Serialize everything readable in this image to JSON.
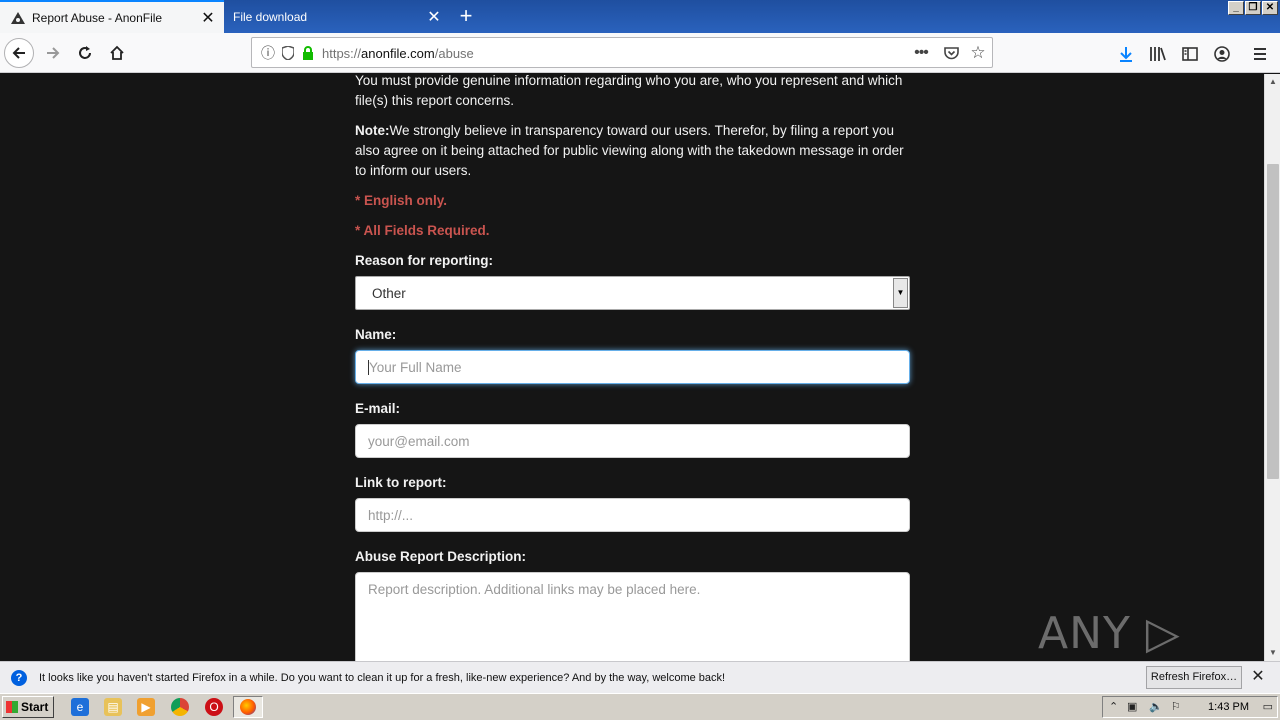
{
  "browser": {
    "tabs": [
      {
        "title": "Report Abuse - AnonFile",
        "active": true,
        "icon": "anonfile-icon"
      },
      {
        "title": "File download",
        "active": false,
        "icon": "none"
      }
    ],
    "url": {
      "scheme": "https://",
      "host": "anonfile.com",
      "path": "/abuse"
    },
    "icons": [
      "back-icon",
      "forward-icon",
      "reload-icon",
      "home-icon",
      "info-icon",
      "shield-icon",
      "lock-icon",
      "page-actions-icon",
      "pocket-icon",
      "bookmark-star-icon",
      "download-icon",
      "library-icon",
      "sidebar-icon",
      "account-icon",
      "menu-icon"
    ]
  },
  "page": {
    "intro_text": "You must provide genuine information regarding who you are, who you represent and which file(s) this report concerns.",
    "note_label": "Note:",
    "note_text": "We strongly believe in transparency toward our users. Therefor, by filing a report you also agree on it being attached for public viewing along with the takedown message in order to inform our users.",
    "requirement_1": "* English only.",
    "requirement_2": "* All Fields Required.",
    "reason_label": "Reason for reporting:",
    "reason_value": "Other",
    "name_label": "Name:",
    "name_placeholder": "Your Full Name",
    "email_label": "E-mail:",
    "email_placeholder": "your@email.com",
    "link_label": "Link to report:",
    "link_placeholder": "http://...",
    "description_label": "Abuse Report Description:",
    "description_placeholder": "Report description. Additional links may be placed here.",
    "colors": {
      "background": "#151515",
      "text": "#f2f2f2",
      "required": "#c9544f",
      "focus": "#66afe9"
    }
  },
  "watermark": "ANY ▷ RUN",
  "notification": {
    "message": "It looks like you haven't started Firefox in a while. Do you want to clean it up for a fresh, like-new experience? And by the way, welcome back!",
    "button": "Refresh Firefox…"
  },
  "taskbar": {
    "start_label": "Start",
    "clock": "1:43 PM",
    "apps": [
      "ie-icon",
      "explorer-icon",
      "media-player-icon",
      "chrome-icon",
      "opera-icon",
      "firefox-icon"
    ]
  }
}
